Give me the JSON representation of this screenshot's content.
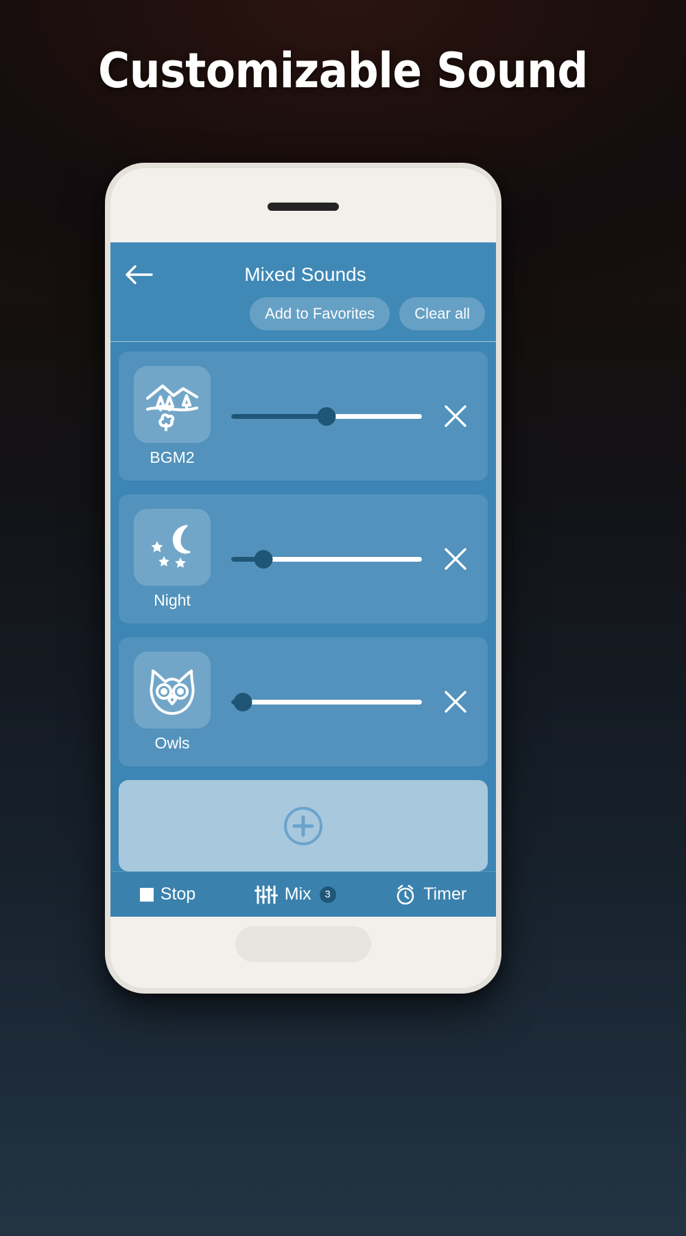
{
  "hero": {
    "title": "Customizable Sound"
  },
  "app": {
    "header": {
      "back_icon": "arrow-left-icon",
      "title": "Mixed Sounds",
      "actions": [
        {
          "label": "Add to Favorites",
          "name": "add-to-favorites-button"
        },
        {
          "label": "Clear all",
          "name": "clear-all-button"
        }
      ]
    },
    "sounds": [
      {
        "name": "BGM2",
        "icon": "landscape-icon",
        "volume": 50,
        "remove_icon": "close-icon"
      },
      {
        "name": "Night",
        "icon": "moon-stars-icon",
        "volume": 17,
        "remove_icon": "close-icon"
      },
      {
        "name": "Owls",
        "icon": "owl-icon",
        "volume": 6,
        "remove_icon": "close-icon"
      }
    ],
    "add_card": {
      "icon": "plus-circle-icon",
      "label": ""
    },
    "bottom_nav": [
      {
        "label": "Stop",
        "icon": "stop-square-icon",
        "badge": ""
      },
      {
        "label": "Mix",
        "icon": "mixer-sliders-icon",
        "badge": "3"
      },
      {
        "label": "Timer",
        "icon": "alarm-clock-icon",
        "badge": ""
      }
    ]
  },
  "colors": {
    "app_blue": "#3d85b4",
    "appbar_blue": "#4089b7",
    "slider_dark": "#1f5576",
    "slider_white": "#ffffff",
    "phone_body": "#f3f0ec"
  }
}
